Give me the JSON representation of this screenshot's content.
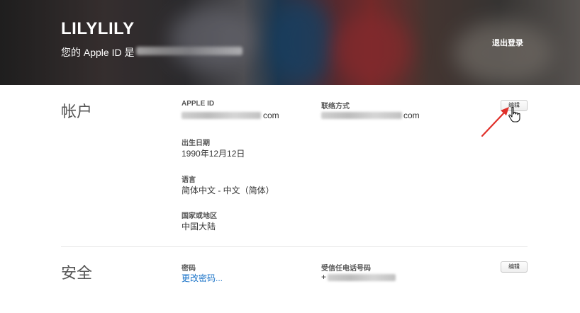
{
  "header": {
    "name": "LILYLILY",
    "apple_id_prefix": "您的 Apple ID 是",
    "sign_out": "退出登录"
  },
  "account": {
    "title": "帐户",
    "apple_id_label": "APPLE ID",
    "apple_id_suffix": "com",
    "contact_label": "联络方式",
    "contact_suffix": "com",
    "birthday_label": "出生日期",
    "birthday_value": "1990年12月12日",
    "language_label": "语言",
    "language_value": "简体中文 - 中文（简体）",
    "region_label": "国家或地区",
    "region_value": "中国大陆",
    "edit_label": "编辑"
  },
  "security": {
    "title": "安全",
    "password_label": "密码",
    "change_password": "更改密码...",
    "trusted_phone_label": "受信任电话号码",
    "phone_prefix": "+",
    "edit_label": "编辑"
  },
  "colors": {
    "link": "#1a73c8",
    "annotation": "#e0302a"
  }
}
